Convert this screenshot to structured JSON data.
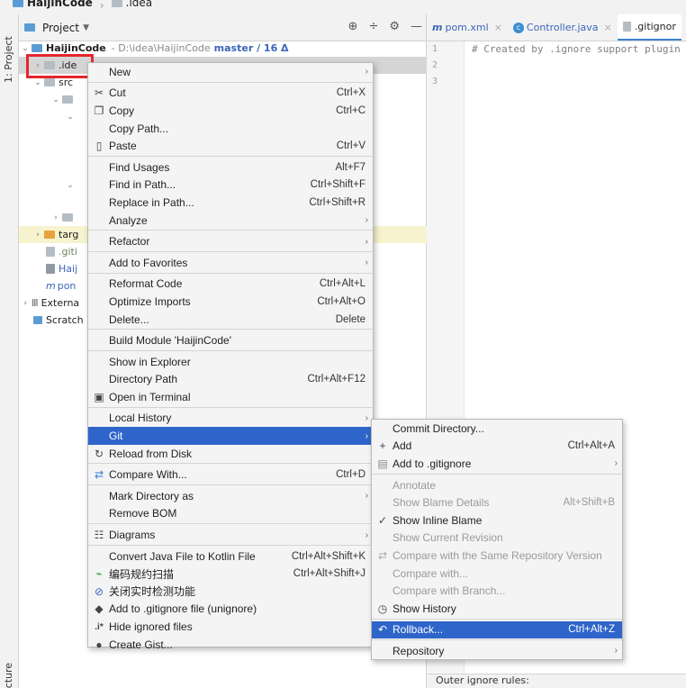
{
  "breadcrumb": [
    "HaijinCode",
    ".idea"
  ],
  "stripe": {
    "project_label": "1: Project",
    "structure_label": "tructure"
  },
  "panel": {
    "title": "Project",
    "root": {
      "name": "HaijinCode",
      "path": "- D:\\idea\\HaijinCode",
      "branch": "master / 16 Δ"
    },
    "rows": [
      ".ide",
      "src",
      "",
      "targ",
      ".giti",
      "Haij",
      "pon",
      "Externa",
      "Scratch"
    ]
  },
  "tabs": [
    {
      "label": "pom.xml",
      "icon": "m"
    },
    {
      "label": "Controller.java",
      "icon": "c"
    },
    {
      "label": ".gitignor",
      "icon": "g"
    }
  ],
  "editor": {
    "lines": [
      "1",
      "2",
      "3"
    ],
    "code_line1": "# Created by .ignore support plugin"
  },
  "bottom_status": "Outer ignore rules:",
  "main_menu": {
    "items": [
      {
        "label": "New",
        "shortcut": "",
        "submenu": true,
        "icon": ""
      },
      {
        "label": "Cut",
        "shortcut": "Ctrl+X",
        "icon": "scissors-icon"
      },
      {
        "label": "Copy",
        "shortcut": "Ctrl+C",
        "icon": "copy-icon"
      },
      {
        "label": "Copy Path...",
        "shortcut": ""
      },
      {
        "label": "Paste",
        "shortcut": "Ctrl+V",
        "icon": "clipboard-icon"
      },
      {
        "label": "Find Usages",
        "shortcut": "Alt+F7"
      },
      {
        "label": "Find in Path...",
        "shortcut": "Ctrl+Shift+F"
      },
      {
        "label": "Replace in Path...",
        "shortcut": "Ctrl+Shift+R"
      },
      {
        "label": "Analyze",
        "shortcut": "",
        "submenu": true
      },
      {
        "label": "Refactor",
        "shortcut": "",
        "submenu": true
      },
      {
        "label": "Add to Favorites",
        "shortcut": "",
        "submenu": true
      },
      {
        "label": "Reformat Code",
        "shortcut": "Ctrl+Alt+L"
      },
      {
        "label": "Optimize Imports",
        "shortcut": "Ctrl+Alt+O"
      },
      {
        "label": "Delete...",
        "shortcut": "Delete"
      },
      {
        "label": "Build Module 'HaijinCode'",
        "shortcut": ""
      },
      {
        "label": "Show in Explorer",
        "shortcut": ""
      },
      {
        "label": "Directory Path",
        "shortcut": "Ctrl+Alt+F12"
      },
      {
        "label": "Open in Terminal",
        "shortcut": "",
        "icon": "terminal-icon"
      },
      {
        "label": "Local History",
        "shortcut": "",
        "submenu": true
      },
      {
        "label": "Git",
        "shortcut": "",
        "submenu": true
      },
      {
        "label": "Reload from Disk",
        "shortcut": "",
        "icon": "reload-icon"
      },
      {
        "label": "Compare With...",
        "shortcut": "Ctrl+D",
        "icon": "compare-icon"
      },
      {
        "label": "Mark Directory as",
        "shortcut": "",
        "submenu": true
      },
      {
        "label": "Remove BOM",
        "shortcut": ""
      },
      {
        "label": "Diagrams",
        "shortcut": "",
        "submenu": true,
        "icon": "diagram-icon"
      },
      {
        "label": "Convert Java File to Kotlin File",
        "shortcut": "Ctrl+Alt+Shift+K"
      },
      {
        "label": "编码规约扫描",
        "shortcut": "Ctrl+Alt+Shift+J",
        "icon": "scan-icon"
      },
      {
        "label": "关闭实时检测功能",
        "shortcut": "",
        "icon": "disable-icon"
      },
      {
        "label": "Add to .gitignore file (unignore)",
        "shortcut": "",
        "icon": "gitignore-icon"
      },
      {
        "label": "Hide ignored files",
        "shortcut": "",
        "icon": ".i*"
      },
      {
        "label": "Create Gist...",
        "shortcut": "",
        "icon": "github-icon"
      }
    ]
  },
  "git_menu": {
    "items": [
      {
        "label": "Commit Directory...",
        "shortcut": ""
      },
      {
        "label": "Add",
        "shortcut": "Ctrl+Alt+A",
        "icon": "+"
      },
      {
        "label": "Add to .gitignore",
        "shortcut": "",
        "submenu": true,
        "icon": "gitignore-icon"
      },
      {
        "label": "Annotate",
        "shortcut": "",
        "disabled": true
      },
      {
        "label": "Show Blame Details",
        "shortcut": "Alt+Shift+B",
        "disabled": true
      },
      {
        "label": "Show Inline Blame",
        "shortcut": "",
        "icon": "✓"
      },
      {
        "label": "Show Current Revision",
        "shortcut": "",
        "disabled": true
      },
      {
        "label": "Compare with the Same Repository Version",
        "shortcut": "",
        "disabled": true,
        "icon": "compare-icon"
      },
      {
        "label": "Compare with...",
        "shortcut": "",
        "disabled": true
      },
      {
        "label": "Compare with Branch...",
        "shortcut": "",
        "disabled": true
      },
      {
        "label": "Show History",
        "shortcut": "",
        "icon": "clock-icon"
      },
      {
        "label": "Rollback...",
        "shortcut": "Ctrl+Alt+Z",
        "icon": "rollback-icon"
      },
      {
        "label": "Repository",
        "shortcut": "",
        "submenu": true
      }
    ]
  }
}
